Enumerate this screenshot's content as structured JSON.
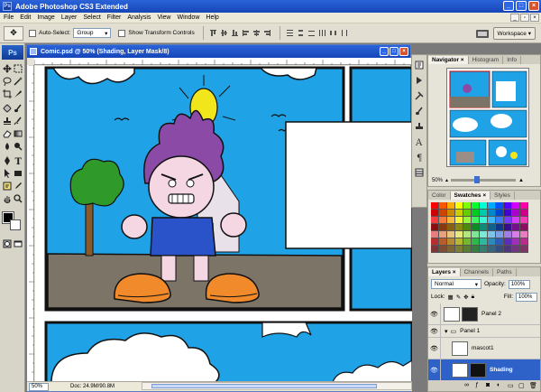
{
  "app": {
    "title": "Adobe Photoshop CS3 Extended",
    "badge": "Ps"
  },
  "menu": [
    "File",
    "Edit",
    "Image",
    "Layer",
    "Select",
    "Filter",
    "Analysis",
    "View",
    "Window",
    "Help"
  ],
  "options": {
    "auto_select_label": "Auto-Select:",
    "auto_select_value": "Group",
    "show_transform_label": "Show Transform Controls",
    "workspace_label": "Workspace"
  },
  "document": {
    "title": "Comic.psd @ 50% (Shading, Layer Mask/8)",
    "zoom": "50%",
    "doc_info": "Doc: 24.9M/90.8M"
  },
  "panels": {
    "navigator_tabs": [
      "Navigator",
      "Histogram",
      "Info"
    ],
    "navigator_zoom": "50%",
    "color_tabs": [
      "Color",
      "Swatches",
      "Styles"
    ],
    "layers_tabs": [
      "Layers",
      "Channels",
      "Paths"
    ],
    "blend_mode": "Normal",
    "opacity_label": "Opacity:",
    "opacity_value": "100%",
    "lock_label": "Lock:",
    "fill_label": "Fill:",
    "fill_value": "100%",
    "layers": [
      {
        "name": "Panel 2",
        "type": "layer"
      },
      {
        "name": "Panel 1",
        "type": "group"
      },
      {
        "name": "mascot1",
        "type": "layer"
      },
      {
        "name": "Shading",
        "type": "layer"
      }
    ]
  },
  "colors": {
    "title_blue": "#1646b8",
    "canvas_sky": "#1fa3e6",
    "ground": "#7d7468",
    "hair": "#8a4aa6",
    "shirt": "#2a53c9",
    "tree": "#2f9a2a",
    "shoes": "#f08a2a"
  }
}
